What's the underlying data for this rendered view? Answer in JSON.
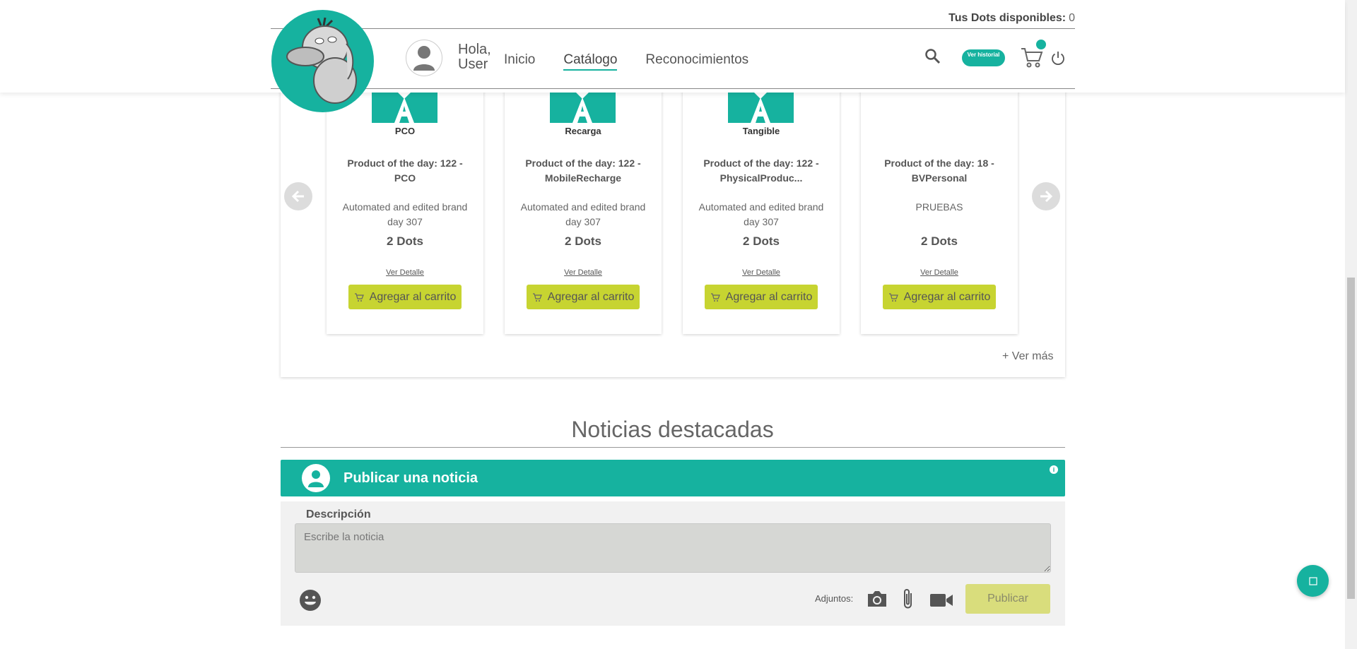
{
  "header": {
    "dots_label": "Tus Dots disponibles:",
    "dots_value": "0",
    "greeting_line1": "Hola,",
    "greeting_line2": "User",
    "nav": [
      "Inicio",
      "Catálogo",
      "Reconocimientos"
    ],
    "active_nav": "Catálogo",
    "history_label": "Ver historial",
    "accent_color": "#16b29f"
  },
  "products": [
    {
      "category": "PCO",
      "title": "Product of the day: 122 - PCO",
      "description": "Automated and edited brand day 307",
      "price": "2 Dots",
      "detail": "Ver Detalle",
      "add": "Agregar al carrito",
      "has_image": true
    },
    {
      "category": "Recarga",
      "title": "Product of the day: 122 - MobileRecharge",
      "description": "Automated and edited brand day 307",
      "price": "2 Dots",
      "detail": "Ver Detalle",
      "add": "Agregar al carrito",
      "has_image": true
    },
    {
      "category": "Tangible",
      "title": "Product of the day: 122 - PhysicalProduc...",
      "description": "Automated and edited brand day 307",
      "price": "2 Dots",
      "detail": "Ver Detalle",
      "add": "Agregar al carrito",
      "has_image": true
    },
    {
      "category": "",
      "title": "Product of the day: 18 - BVPersonal",
      "description": "PRUEBAS",
      "price": "2 Dots",
      "detail": "Ver Detalle",
      "add": "Agregar al carrito",
      "has_image": false
    }
  ],
  "see_more": "+ Ver más",
  "news": {
    "title": "Noticias destacadas",
    "publish_header": "Publicar una noticia",
    "info_glyph": "i",
    "description_label": "Descripción",
    "placeholder": "Escribe la noticia",
    "attachments_label": "Adjuntos:",
    "publish_button": "Publicar"
  },
  "icons": [
    "search-icon",
    "cart-icon",
    "power-icon",
    "user-icon",
    "emoji-icon",
    "camera-icon",
    "paperclip-icon",
    "video-icon",
    "chat-icon",
    "arrow-left-icon",
    "arrow-right-icon"
  ]
}
